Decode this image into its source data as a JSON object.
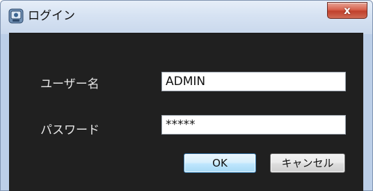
{
  "window": {
    "title": "ログイン",
    "close_label": "x",
    "title_icon": "app-icon"
  },
  "form": {
    "username_label": "ユーザー名",
    "username_value": "ADMIN",
    "password_label": "パスワード",
    "password_value": "*****"
  },
  "buttons": {
    "ok_label": "OK",
    "cancel_label": "キャンセル"
  },
  "colors": {
    "dialog_background": "#202020",
    "ok_button_border": "#3c7fb1",
    "close_button": "#c0402c"
  }
}
